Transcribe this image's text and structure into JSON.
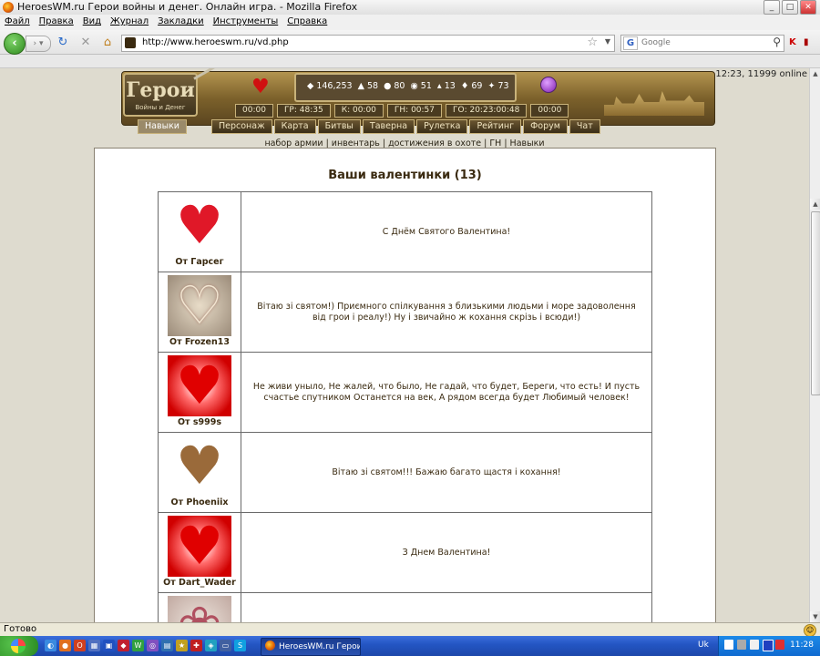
{
  "browser": {
    "title": "HeroesWM.ru Герои войны и денег. Онлайн игра. - Mozilla Firefox",
    "menu": [
      "Файл",
      "Правка",
      "Вид",
      "Журнал",
      "Закладки",
      "Инструменты",
      "Справка"
    ],
    "url": "http://www.heroeswm.ru/vd.php",
    "search_placeholder": "Google",
    "status": "Готово"
  },
  "game_header": {
    "logo_title": "Герои",
    "logo_subtitle": "Войны и Денег",
    "online": "12:23, 11999 online",
    "resources": [
      {
        "icon": "gold-icon",
        "value": "146,253"
      },
      {
        "icon": "wood-icon",
        "value": "58"
      },
      {
        "icon": "ore-icon",
        "value": "80"
      },
      {
        "icon": "mercury-icon",
        "value": "51"
      },
      {
        "icon": "sulfur-icon",
        "value": "13"
      },
      {
        "icon": "crystal-icon",
        "value": "69"
      },
      {
        "icon": "gems-icon",
        "value": "73"
      }
    ],
    "timers": [
      "00:00",
      "ГР: 48:35",
      "К: 00:00",
      "ГН: 00:57",
      "ГО: 20:23:00:48",
      "00:00"
    ],
    "nav": [
      "Навыки",
      "Персонаж",
      "Карта",
      "Битвы",
      "Таверна",
      "Рулетка",
      "Рейтинг",
      "Форум",
      "Чат"
    ],
    "sublinks": "набор армии | инвентарь | достижения в охоте | ГН | Навыки"
  },
  "page": {
    "title": "Ваши валентинки (13)",
    "valentines": [
      {
        "from": "От Гарсег",
        "message": "С Днём Святого Валентина!"
      },
      {
        "from": "От Frozen13",
        "message": "Вітаю зі святом!) Приємного спілкування з близькими людьми і море задоволення від грои і реалу!) Ну і звичайно ж кохання скрізь і всюди!)"
      },
      {
        "from": "От s999s",
        "message": "Не живи уныло, Не жалей, что было, Не гадай, что будет, Береги, что есть! И пусть счастье спутником Останется на век, А рядом всегда будет Любимый человек!"
      },
      {
        "from": "От Phoeniix",
        "message": "Вітаю зі святом!!! Бажаю багато щастя і кохання!"
      },
      {
        "from": "От Dart_Wader",
        "message": "З Днем Валентина!"
      }
    ]
  },
  "taskbar": {
    "task_label": "HeroesWM.ru Герои...",
    "lang": "Uk",
    "clock": "11:28"
  }
}
